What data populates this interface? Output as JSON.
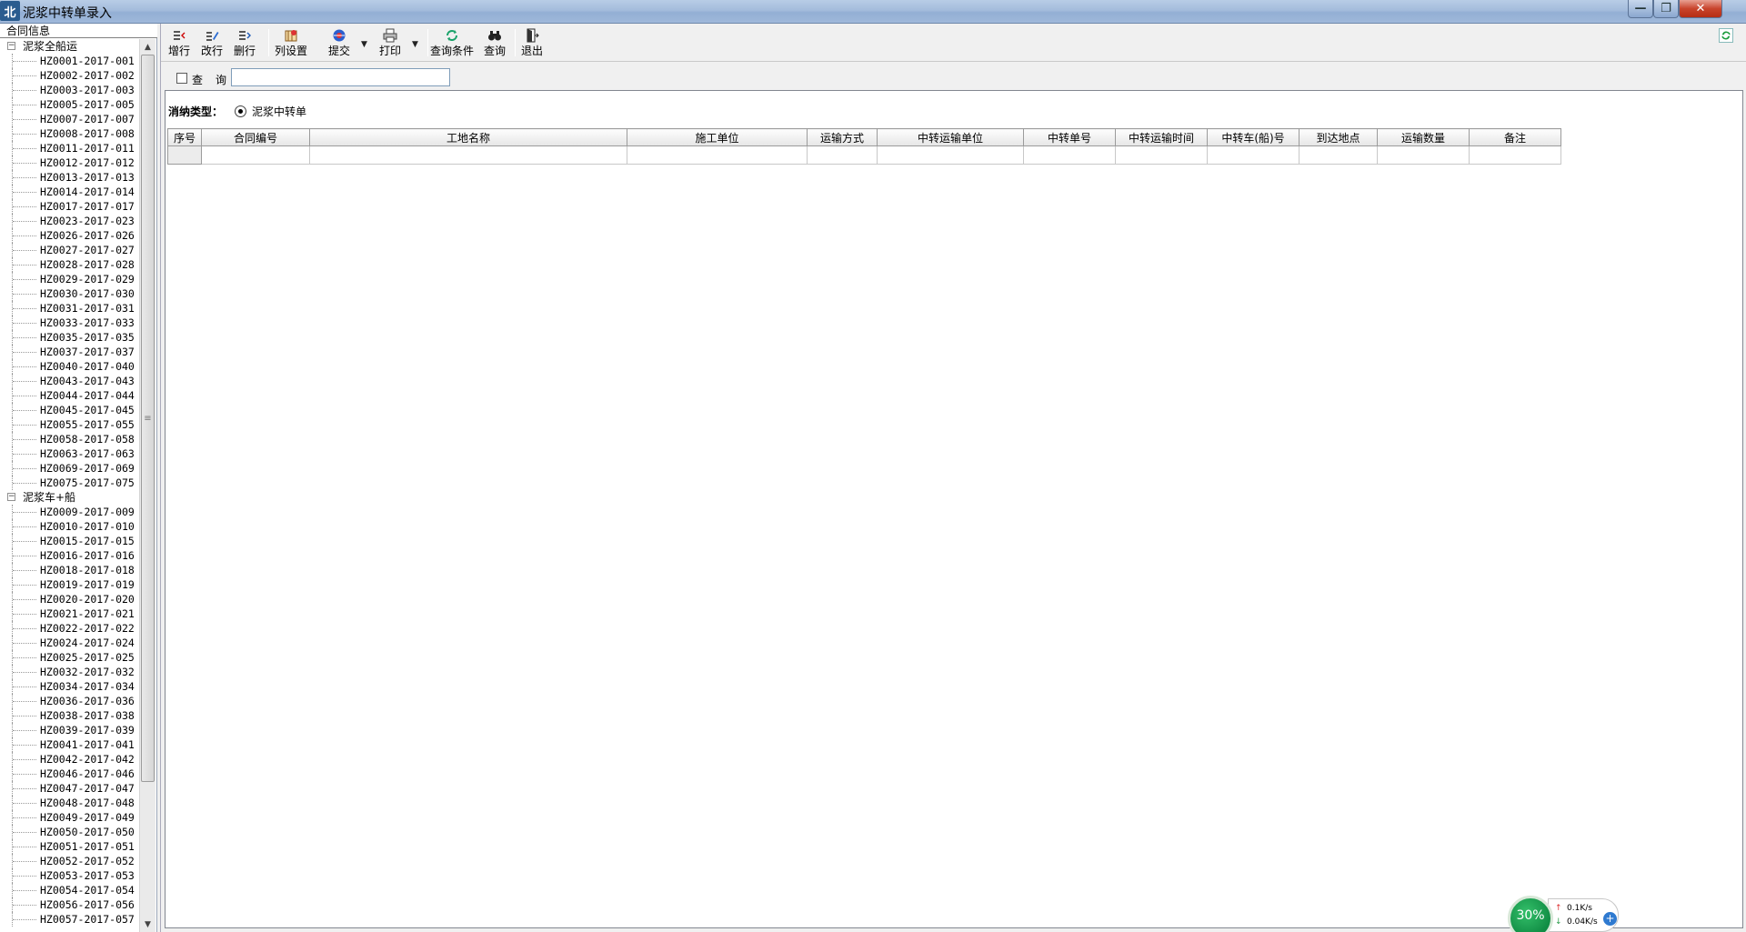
{
  "window": {
    "logo_text": "北",
    "title": "泥浆中转单录入",
    "ghost_title": "",
    "minimize": "—",
    "maximize": "❐",
    "close": "✕"
  },
  "left_panel": {
    "header": "合同信息",
    "groups": [
      {
        "label": "泥浆全船运",
        "toggle": "−",
        "items": [
          "HZ0001-2017-001",
          "HZ0002-2017-002",
          "HZ0003-2017-003",
          "HZ0005-2017-005",
          "HZ0007-2017-007",
          "HZ0008-2017-008",
          "HZ0011-2017-011",
          "HZ0012-2017-012",
          "HZ0013-2017-013",
          "HZ0014-2017-014",
          "HZ0017-2017-017",
          "HZ0023-2017-023",
          "HZ0026-2017-026",
          "HZ0027-2017-027",
          "HZ0028-2017-028",
          "HZ0029-2017-029",
          "HZ0030-2017-030",
          "HZ0031-2017-031",
          "HZ0033-2017-033",
          "HZ0035-2017-035",
          "HZ0037-2017-037",
          "HZ0040-2017-040",
          "HZ0043-2017-043",
          "HZ0044-2017-044",
          "HZ0045-2017-045",
          "HZ0055-2017-055",
          "HZ0058-2017-058",
          "HZ0063-2017-063",
          "HZ0069-2017-069",
          "HZ0075-2017-075"
        ]
      },
      {
        "label": "泥浆车+船",
        "toggle": "−",
        "items": [
          "HZ0009-2017-009",
          "HZ0010-2017-010",
          "HZ0015-2017-015",
          "HZ0016-2017-016",
          "HZ0018-2017-018",
          "HZ0019-2017-019",
          "HZ0020-2017-020",
          "HZ0021-2017-021",
          "HZ0022-2017-022",
          "HZ0024-2017-024",
          "HZ0025-2017-025",
          "HZ0032-2017-032",
          "HZ0034-2017-034",
          "HZ0036-2017-036",
          "HZ0038-2017-038",
          "HZ0039-2017-039",
          "HZ0041-2017-041",
          "HZ0042-2017-042",
          "HZ0046-2017-046",
          "HZ0047-2017-047",
          "HZ0048-2017-048",
          "HZ0049-2017-049",
          "HZ0050-2017-050",
          "HZ0051-2017-051",
          "HZ0052-2017-052",
          "HZ0053-2017-053",
          "HZ0054-2017-054",
          "HZ0056-2017-056",
          "HZ0057-2017-057"
        ]
      }
    ],
    "scroll_up": "▲",
    "scroll_down": "▼",
    "scroll_grip": "≡"
  },
  "toolbar": {
    "add_row": "增行",
    "edit_row": "改行",
    "delete_row": "删行",
    "column_settings": "列设置",
    "submit": "提交",
    "print": "打印",
    "query_conditions": "查询条件",
    "query": "查询",
    "exit": "退出",
    "dropdown_arrow": "▼"
  },
  "query_bar": {
    "label": "查询",
    "input_value": "",
    "input_placeholder": ""
  },
  "content": {
    "type_label": "消纳类型：",
    "radio_option": "泥浆中转单"
  },
  "grid": {
    "columns": [
      "序号",
      "合同编号",
      "工地名称",
      "施工单位",
      "运输方式",
      "中转运输单位",
      "中转单号",
      "中转运输时间",
      "中转车(船)号",
      "到达地点",
      "运输数量",
      "备注"
    ]
  },
  "net_widget": {
    "percent": "30%",
    "upload_arrow": "↑",
    "download_arrow": "↓",
    "upload": "0.1K/s",
    "download": "0.04K/s",
    "plus": "+"
  },
  "colors": {
    "title_bar": "#a4bcdc",
    "close_button": "#c8442c",
    "net_green": "#108c44",
    "net_plus": "#2f7ad0"
  }
}
